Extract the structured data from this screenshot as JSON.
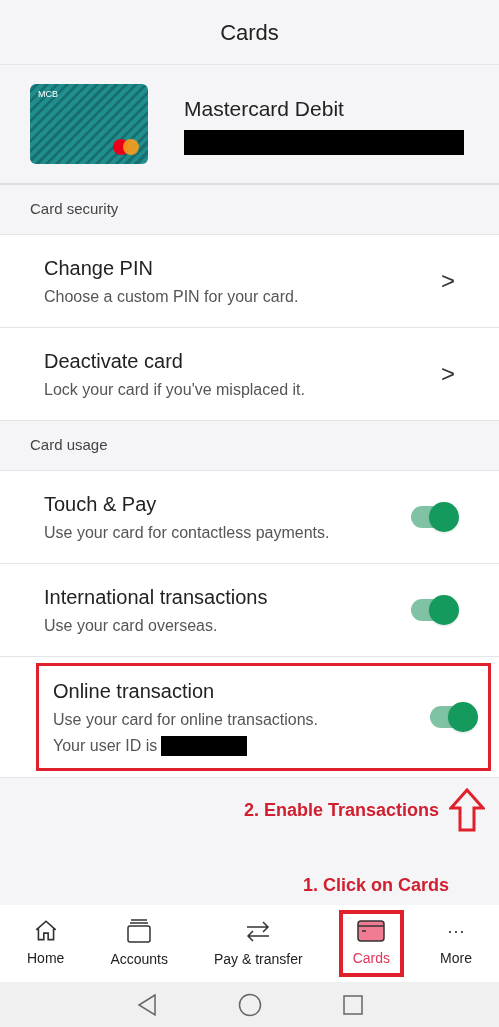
{
  "header": {
    "title": "Cards"
  },
  "card": {
    "logo_text": "MCB",
    "name": "Mastercard Debit"
  },
  "sections": [
    {
      "title": "Card security",
      "rows": [
        {
          "kind": "link",
          "title": "Change PIN",
          "subtitle": "Choose a custom PIN for your card.",
          "chevron": ">",
          "highlighted": false
        },
        {
          "kind": "link",
          "title": "Deactivate card",
          "subtitle": "Lock your card if you've misplaced it.",
          "chevron": ">",
          "highlighted": false
        }
      ]
    },
    {
      "title": "Card usage",
      "rows": [
        {
          "kind": "toggle",
          "title": "Touch & Pay",
          "subtitle": "Use your card for contactless payments.",
          "on": true,
          "highlighted": false
        },
        {
          "kind": "toggle",
          "title": "International transactions",
          "subtitle": "Use your card overseas.",
          "on": true,
          "highlighted": false
        },
        {
          "kind": "toggle",
          "title": "Online transaction",
          "subtitle": "Use your card for online transactions.",
          "extra": "Your user ID is",
          "on": true,
          "highlighted": true
        }
      ]
    }
  ],
  "annotations": {
    "step2": "2. Enable Transactions",
    "step1": "1. Click on Cards"
  },
  "nav": [
    {
      "kind": "home",
      "label": "Home",
      "selected": false
    },
    {
      "kind": "accounts",
      "label": "Accounts",
      "selected": false
    },
    {
      "kind": "transfer",
      "label": "Pay & transfer",
      "selected": false
    },
    {
      "kind": "cards",
      "label": "Cards",
      "selected": true
    },
    {
      "kind": "more",
      "label": "More",
      "icon_text": "···",
      "selected": false
    }
  ]
}
